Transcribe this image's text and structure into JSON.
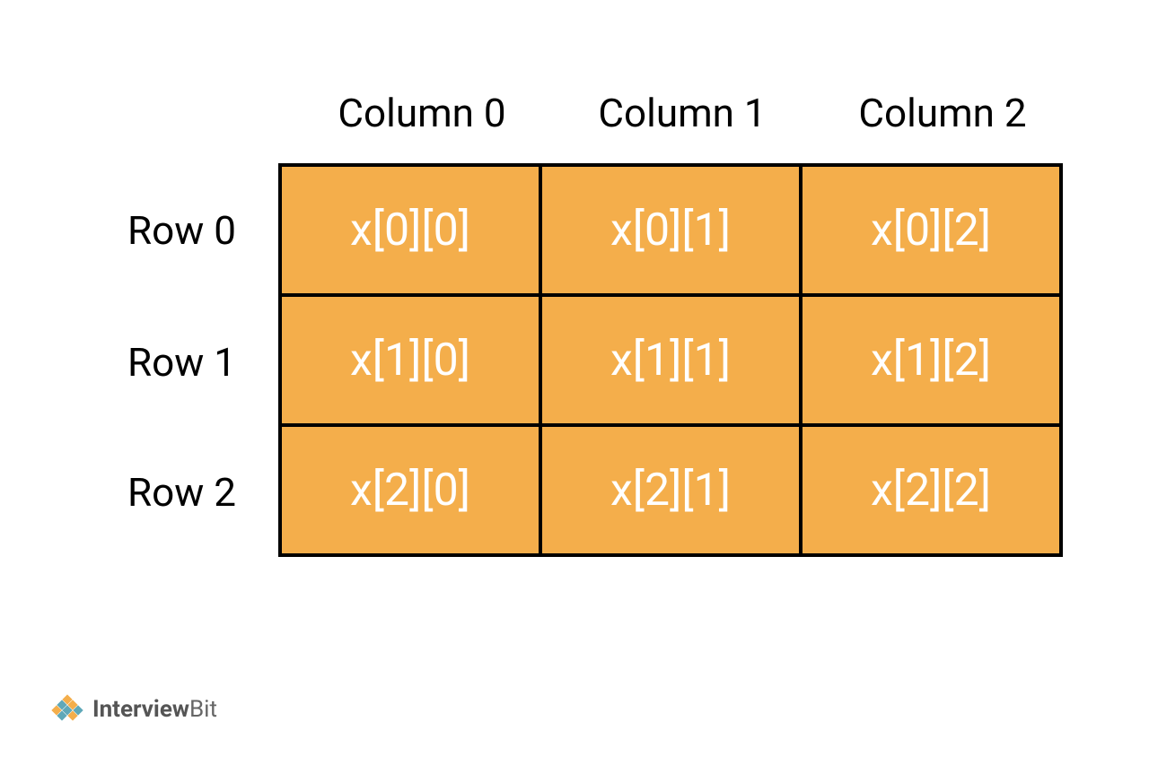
{
  "columns": [
    "Column 0",
    "Column 1",
    "Column 2"
  ],
  "rows": [
    {
      "label": "Row 0",
      "cells": [
        "x[0][0]",
        "x[0][1]",
        "x[0][2]"
      ]
    },
    {
      "label": "Row 1",
      "cells": [
        "x[1][0]",
        "x[1][1]",
        "x[1][2]"
      ]
    },
    {
      "label": "Row 2",
      "cells": [
        "x[2][0]",
        "x[2][1]",
        "x[2][2]"
      ]
    }
  ],
  "logo": {
    "text_bold": "Interview",
    "text_light": "Bit"
  },
  "colors": {
    "cell_bg": "#F4AE4B",
    "cell_text": "#FFFFFF",
    "border": "#000000"
  }
}
